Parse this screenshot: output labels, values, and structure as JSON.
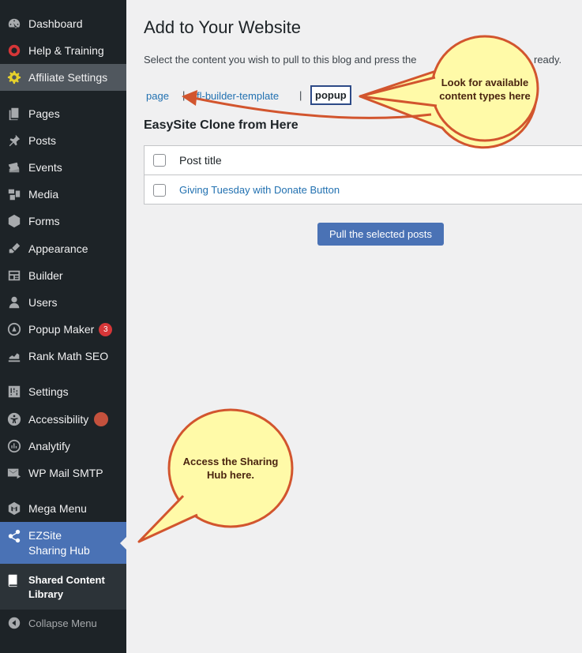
{
  "sidebar": {
    "items": [
      {
        "label": "Dashboard",
        "icon": "dashboard-icon"
      },
      {
        "label": "Help & Training",
        "icon": "lifebuoy-icon"
      },
      {
        "label": "Affiliate Settings",
        "icon": "gear-icon"
      },
      {
        "label": "Pages",
        "icon": "pages-icon"
      },
      {
        "label": "Posts",
        "icon": "pin-icon"
      },
      {
        "label": "Events",
        "icon": "tickets-icon"
      },
      {
        "label": "Media",
        "icon": "media-icon"
      },
      {
        "label": "Forms",
        "icon": "forms-icon"
      },
      {
        "label": "Appearance",
        "icon": "brush-icon"
      },
      {
        "label": "Builder",
        "icon": "builder-icon"
      },
      {
        "label": "Users",
        "icon": "user-icon"
      },
      {
        "label": "Popup Maker",
        "icon": "popup-icon",
        "badge": "3"
      },
      {
        "label": "Rank Math SEO",
        "icon": "chart-icon"
      },
      {
        "label": "Settings",
        "icon": "settings-sliders-icon"
      },
      {
        "label": "Accessibility",
        "icon": "accessibility-icon"
      },
      {
        "label": "Analytify",
        "icon": "analytify-icon"
      },
      {
        "label": "WP Mail SMTP",
        "icon": "mail-icon"
      },
      {
        "label": "Mega Menu",
        "icon": "megamenu-icon"
      },
      {
        "label": "EZSite Sharing Hub",
        "label_line1": "EZSite",
        "label_line2": "Sharing Hub",
        "icon": "share-icon"
      }
    ],
    "submenu": {
      "line1": "Shared Content",
      "line2": "Library",
      "icon": "book-icon"
    },
    "collapse_label": "Collapse Menu"
  },
  "main": {
    "title": "Add to Your Website",
    "description": "Select the content you wish to pull to this blog and press the",
    "description_end": "ready.",
    "content_types": [
      "page",
      "fl-builder-template",
      "popup"
    ],
    "separator": "|",
    "current_type": "popup",
    "section_title": "EasySite Clone from Here",
    "table": {
      "header": "Post title",
      "rows": [
        "Giving Tuesday with Donate Button"
      ]
    },
    "button_label": "Pull the selected posts"
  },
  "callouts": {
    "top": "Look for available content types here",
    "top_line1": "Look for available",
    "top_line2": "content types here",
    "bottom_line1": "Access the Sharing",
    "bottom_line2": "Hub here."
  },
  "colors": {
    "sidebar_bg": "#1d2327",
    "accent_blue": "#4a72b5",
    "callout_fill": "#fffaa8",
    "callout_stroke": "#d2552e",
    "badge_red": "#d63638"
  }
}
